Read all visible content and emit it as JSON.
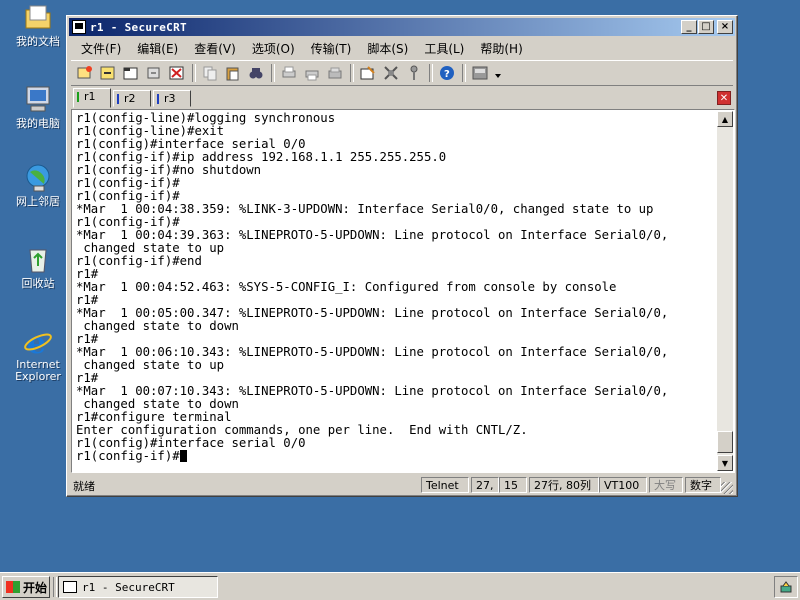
{
  "desktop": {
    "icons": [
      {
        "label": "我的文档",
        "icon": "my-documents-icon"
      },
      {
        "label": "我的电脑",
        "icon": "my-computer-icon"
      },
      {
        "label": "网上邻居",
        "icon": "network-icon"
      },
      {
        "label": "回收站",
        "icon": "recycle-bin-icon"
      },
      {
        "label_line1": "Internet",
        "label_line2": "Explorer",
        "icon": "internet-explorer-icon"
      }
    ]
  },
  "window": {
    "title": "r1 - SecureCRT",
    "controls": {
      "minimize": "_",
      "maximize": "□",
      "close": "×"
    }
  },
  "menu": [
    {
      "label": "文件(F)"
    },
    {
      "label": "编辑(E)"
    },
    {
      "label": "查看(V)"
    },
    {
      "label": "选项(O)"
    },
    {
      "label": "传输(T)"
    },
    {
      "label": "脚本(S)"
    },
    {
      "label": "工具(L)"
    },
    {
      "label": "帮助(H)"
    }
  ],
  "tabs": [
    {
      "label": "r1",
      "color": "#1aa01a",
      "active": true
    },
    {
      "label": "r2",
      "color": "#2040c0",
      "active": false
    },
    {
      "label": "r3",
      "color": "#2040c0",
      "active": false
    }
  ],
  "terminal": {
    "lines": [
      "r1(config-line)#logging synchronous",
      "r1(config-line)#exit",
      "r1(config)#interface serial 0/0",
      "r1(config-if)#ip address 192.168.1.1 255.255.255.0",
      "r1(config-if)#no shutdown",
      "r1(config-if)#",
      "r1(config-if)#",
      "*Mar  1 00:04:38.359: %LINK-3-UPDOWN: Interface Serial0/0, changed state to up",
      "r1(config-if)#",
      "*Mar  1 00:04:39.363: %LINEPROTO-5-UPDOWN: Line protocol on Interface Serial0/0,",
      " changed state to up",
      "r1(config-if)#end",
      "r1#",
      "*Mar  1 00:04:52.463: %SYS-5-CONFIG_I: Configured from console by console",
      "r1#",
      "*Mar  1 00:05:00.347: %LINEPROTO-5-UPDOWN: Line protocol on Interface Serial0/0,",
      " changed state to down",
      "r1#",
      "*Mar  1 00:06:10.343: %LINEPROTO-5-UPDOWN: Line protocol on Interface Serial0/0,",
      " changed state to up",
      "r1#",
      "*Mar  1 00:07:10.343: %LINEPROTO-5-UPDOWN: Line protocol on Interface Serial0/0,",
      " changed state to down",
      "r1#configure terminal",
      "Enter configuration commands, one per line.  End with CNTL/Z.",
      "r1(config)#interface serial 0/0"
    ],
    "prompt": "r1(config-if)#"
  },
  "status": {
    "ready": "就绪",
    "protocol": "Telnet",
    "row": "27,",
    "col": "15",
    "size": "27行, 80列",
    "emulation": "VT100",
    "caps": "大写",
    "num": "数字"
  },
  "taskbar": {
    "start": "开始",
    "task": "r1 - SecureCRT"
  }
}
